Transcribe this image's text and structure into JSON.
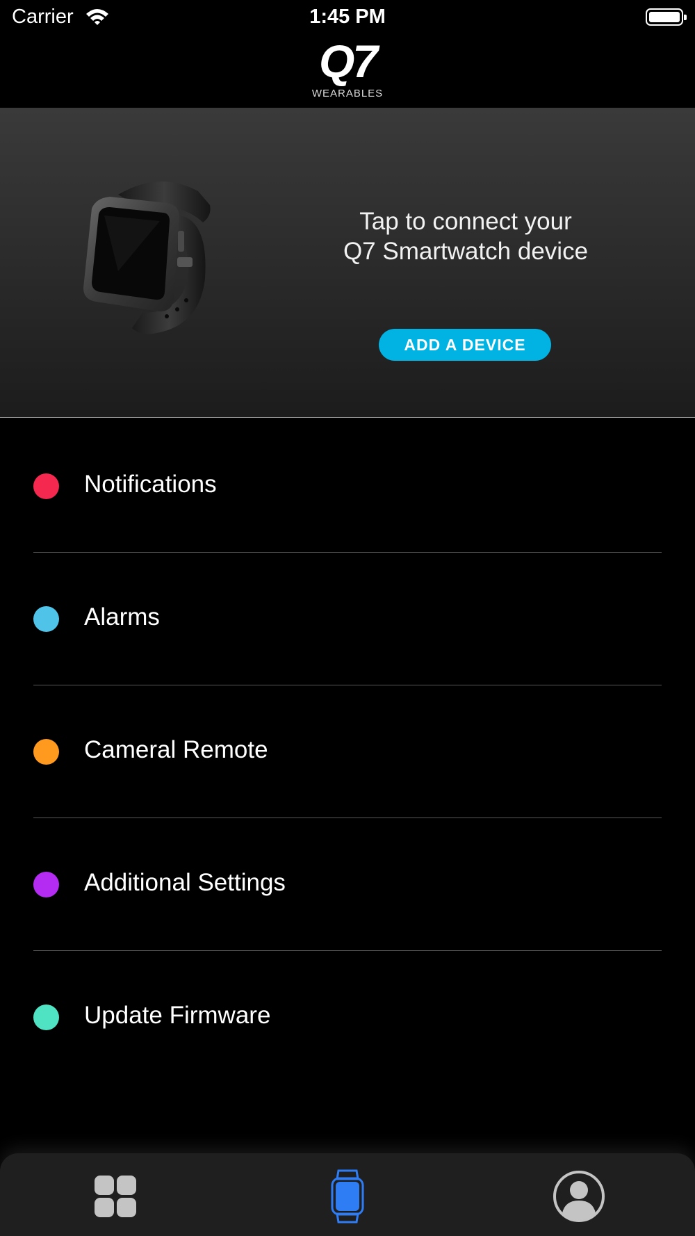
{
  "status_bar": {
    "carrier": "Carrier",
    "time": "1:45 PM",
    "wifi_icon": "wifi-icon",
    "battery_icon": "battery-icon"
  },
  "header": {
    "logo_mark": "Q7",
    "logo_subtitle": "WEARABLES"
  },
  "device_panel": {
    "image_icon": "smartwatch-image",
    "connect_text": "Tap to connect your Q7 Smartwatch device",
    "add_button_label": "ADD A DEVICE",
    "button_color": "#00b3e3"
  },
  "menu": {
    "items": [
      {
        "label": "Notifications",
        "color": "#f5294f"
      },
      {
        "label": "Alarms",
        "color": "#4fc3e8"
      },
      {
        "label": "Cameral Remote",
        "color": "#ff9a1f"
      },
      {
        "label": "Additional Settings",
        "color": "#b42cf2"
      },
      {
        "label": "Update Firmware",
        "color": "#4fe3c4"
      }
    ]
  },
  "tab_bar": {
    "tabs": [
      {
        "icon": "grid-icon",
        "active": false
      },
      {
        "icon": "watch-icon",
        "active": true,
        "color": "#2f7df5"
      },
      {
        "icon": "profile-icon",
        "active": false
      }
    ]
  }
}
